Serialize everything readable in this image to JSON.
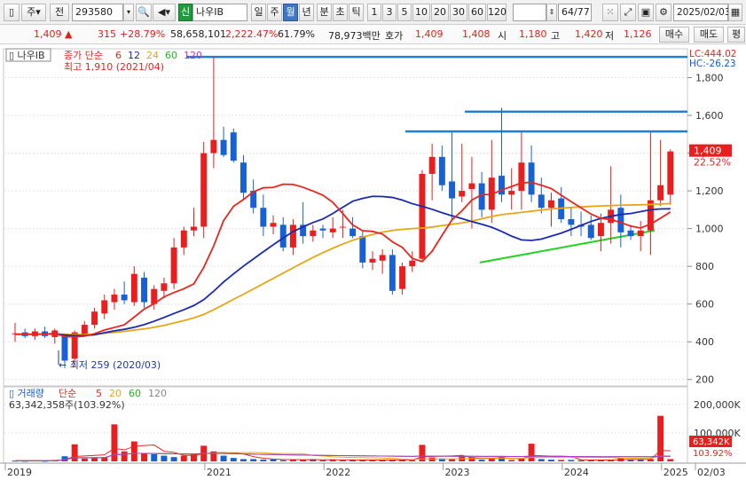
{
  "toolbar": {
    "market_btn": "주",
    "type_btn": "전",
    "code": "293580",
    "new_badge": "신",
    "name": "나우IB",
    "periods": [
      "일",
      "주",
      "월",
      "년",
      "분",
      "초",
      "틱"
    ],
    "selected_period": "월",
    "intervals": [
      "1",
      "3",
      "5",
      "10",
      "20",
      "30",
      "60",
      "120"
    ],
    "page": "64/77",
    "date": "2025/02/03"
  },
  "quote": {
    "price": "1,409",
    "arrow": "▲",
    "change": "315",
    "change_pct": "+28.79%",
    "volume": "58,658,101",
    "vol_pct": "2,222.47%",
    "turnover_pct": "61.79%",
    "amount": "78,973백만",
    "hoga_label": "호가",
    "ask": "1,409",
    "bid": "1,408",
    "open_label": "시",
    "open": "1,180",
    "high_label": "고",
    "high": "1,420",
    "low_label": "저",
    "low": "1,126",
    "buy_btn": "매수",
    "sell_btn": "매도",
    "eval_btn": "평"
  },
  "price_panel": {
    "name_tag": "나우IB",
    "ma_label": "종가 단순",
    "ma_periods": [
      "6",
      "12",
      "24",
      "60",
      "120"
    ],
    "ma_colors": [
      "#e8261d",
      "#1a2bb0",
      "#e8a617",
      "#1fb81f",
      "#b535c8"
    ],
    "high_note": "최고 1,910 (2021/04)",
    "low_note": "최저 259 (2020/03)",
    "lc": "LC:444.02",
    "hc": "HC:-26.23",
    "last_price": "1,409",
    "last_pct": "22.52%"
  },
  "volume_panel": {
    "title": "거래량",
    "ma_label": "단순",
    "ma_periods": [
      "5",
      "20",
      "60",
      "120"
    ],
    "ma_colors": [
      "#e8261d",
      "#e8a617",
      "#1fb81f",
      "#888888"
    ],
    "value_text": "63,342,358주(103.92%)",
    "tag_value": "63,342K",
    "tag_pct": "103.92%"
  },
  "x_axis": [
    "2019",
    "2021",
    "2022",
    "2023",
    "2024",
    "2025",
    "02/03"
  ],
  "chart_data": {
    "type": "candlestick",
    "price_axis_ticks": [
      200,
      400,
      600,
      800,
      "1,000",
      "1,200",
      "1,400",
      "1,600",
      "1,800"
    ],
    "volume_axis_ticks": [
      "100,000K",
      "200,000K"
    ],
    "ylim": [
      180,
      1920
    ],
    "volume_ylim": [
      0,
      240000
    ],
    "bars": [
      {
        "o": 440,
        "h": 500,
        "l": 400,
        "c": 445
      },
      {
        "o": 450,
        "h": 470,
        "l": 420,
        "c": 430
      },
      {
        "o": 430,
        "h": 470,
        "l": 410,
        "c": 455
      },
      {
        "o": 455,
        "h": 480,
        "l": 420,
        "c": 430
      },
      {
        "o": 425,
        "h": 470,
        "l": 390,
        "c": 460
      },
      {
        "o": 430,
        "h": 440,
        "l": 260,
        "c": 300
      },
      {
        "o": 310,
        "h": 460,
        "l": 270,
        "c": 450
      },
      {
        "o": 440,
        "h": 510,
        "l": 430,
        "c": 490
      },
      {
        "o": 490,
        "h": 580,
        "l": 470,
        "c": 560
      },
      {
        "o": 550,
        "h": 650,
        "l": 520,
        "c": 620
      },
      {
        "o": 610,
        "h": 680,
        "l": 570,
        "c": 650
      },
      {
        "o": 650,
        "h": 720,
        "l": 600,
        "c": 620
      },
      {
        "o": 610,
        "h": 800,
        "l": 590,
        "c": 760
      },
      {
        "o": 740,
        "h": 770,
        "l": 580,
        "c": 610
      },
      {
        "o": 600,
        "h": 700,
        "l": 570,
        "c": 680
      },
      {
        "o": 670,
        "h": 740,
        "l": 630,
        "c": 710
      },
      {
        "o": 710,
        "h": 950,
        "l": 680,
        "c": 900
      },
      {
        "o": 900,
        "h": 1010,
        "l": 860,
        "c": 990
      },
      {
        "o": 990,
        "h": 1110,
        "l": 960,
        "c": 1010
      },
      {
        "o": 1010,
        "h": 1460,
        "l": 950,
        "c": 1400
      },
      {
        "o": 1400,
        "h": 1910,
        "l": 1320,
        "c": 1470
      },
      {
        "o": 1470,
        "h": 1540,
        "l": 1380,
        "c": 1390
      },
      {
        "o": 1510,
        "h": 1530,
        "l": 1350,
        "c": 1360
      },
      {
        "o": 1350,
        "h": 1390,
        "l": 1150,
        "c": 1190
      },
      {
        "o": 1200,
        "h": 1260,
        "l": 1080,
        "c": 1110
      },
      {
        "o": 1110,
        "h": 1180,
        "l": 960,
        "c": 1010
      },
      {
        "o": 1010,
        "h": 1070,
        "l": 970,
        "c": 1030
      },
      {
        "o": 1020,
        "h": 1060,
        "l": 880,
        "c": 900
      },
      {
        "o": 900,
        "h": 1050,
        "l": 860,
        "c": 1020
      },
      {
        "o": 1020,
        "h": 1140,
        "l": 920,
        "c": 960
      },
      {
        "o": 960,
        "h": 1020,
        "l": 930,
        "c": 990
      },
      {
        "o": 1000,
        "h": 1020,
        "l": 950,
        "c": 990
      },
      {
        "o": 980,
        "h": 1060,
        "l": 950,
        "c": 1000
      },
      {
        "o": 1010,
        "h": 1100,
        "l": 950,
        "c": 1010
      },
      {
        "o": 1000,
        "h": 1060,
        "l": 950,
        "c": 960
      },
      {
        "o": 960,
        "h": 990,
        "l": 790,
        "c": 820
      },
      {
        "o": 820,
        "h": 880,
        "l": 780,
        "c": 840
      },
      {
        "o": 830,
        "h": 890,
        "l": 760,
        "c": 860
      },
      {
        "o": 860,
        "h": 890,
        "l": 650,
        "c": 670
      },
      {
        "o": 680,
        "h": 820,
        "l": 650,
        "c": 800
      },
      {
        "o": 800,
        "h": 880,
        "l": 770,
        "c": 830
      },
      {
        "o": 840,
        "h": 1310,
        "l": 830,
        "c": 1290
      },
      {
        "o": 1290,
        "h": 1450,
        "l": 1150,
        "c": 1380
      },
      {
        "o": 1380,
        "h": 1440,
        "l": 1200,
        "c": 1230
      },
      {
        "o": 1250,
        "h": 1510,
        "l": 1040,
        "c": 1160
      },
      {
        "o": 1170,
        "h": 1450,
        "l": 1140,
        "c": 1200
      },
      {
        "o": 1210,
        "h": 1380,
        "l": 1000,
        "c": 1240
      },
      {
        "o": 1240,
        "h": 1300,
        "l": 1060,
        "c": 1100
      },
      {
        "o": 1100,
        "h": 1470,
        "l": 1030,
        "c": 1270
      },
      {
        "o": 1280,
        "h": 1640,
        "l": 1140,
        "c": 1180
      },
      {
        "o": 1180,
        "h": 1320,
        "l": 1100,
        "c": 1200
      },
      {
        "o": 1200,
        "h": 1510,
        "l": 1100,
        "c": 1350
      },
      {
        "o": 1350,
        "h": 1440,
        "l": 1140,
        "c": 1180
      },
      {
        "o": 1180,
        "h": 1270,
        "l": 1080,
        "c": 1110
      },
      {
        "o": 1110,
        "h": 1190,
        "l": 1010,
        "c": 1150
      },
      {
        "o": 1160,
        "h": 1220,
        "l": 1030,
        "c": 1050
      },
      {
        "o": 1050,
        "h": 1110,
        "l": 960,
        "c": 1020
      },
      {
        "o": 1020,
        "h": 1090,
        "l": 960,
        "c": 1010
      },
      {
        "o": 1020,
        "h": 1070,
        "l": 940,
        "c": 950
      },
      {
        "o": 960,
        "h": 1080,
        "l": 880,
        "c": 1030
      },
      {
        "o": 1030,
        "h": 1330,
        "l": 920,
        "c": 1100
      },
      {
        "o": 1110,
        "h": 1180,
        "l": 900,
        "c": 980
      },
      {
        "o": 990,
        "h": 1020,
        "l": 940,
        "c": 960
      },
      {
        "o": 960,
        "h": 1040,
        "l": 880,
        "c": 990
      },
      {
        "o": 990,
        "h": 1510,
        "l": 860,
        "c": 1150
      },
      {
        "o": 1150,
        "h": 1470,
        "l": 1120,
        "c": 1230
      },
      {
        "o": 1180,
        "h": 1420,
        "l": 1126,
        "c": 1409
      }
    ],
    "ma6": [
      440,
      440,
      440,
      441,
      444,
      428,
      426,
      430,
      443,
      462,
      476,
      490,
      531,
      573,
      602,
      638,
      661,
      681,
      707,
      794,
      908,
      1042,
      1118,
      1154,
      1195,
      1216,
      1218,
      1235,
      1234,
      1219,
      1199,
      1177,
      1139,
      1080,
      1019,
      989,
      985,
      971,
      930,
      900,
      842,
      825,
      880,
      964,
      1046,
      1094,
      1151,
      1180,
      1181,
      1205,
      1223,
      1242,
      1245,
      1230,
      1212,
      1177,
      1143,
      1110,
      1077,
      1054,
      1048,
      1032,
      1013,
      1003,
      1024,
      1055,
      1088
    ],
    "ma12": [
      440,
      440,
      440,
      441,
      442,
      436,
      433,
      433,
      437,
      448,
      458,
      466,
      477,
      491,
      509,
      529,
      550,
      570,
      592,
      623,
      668,
      717,
      760,
      801,
      839,
      877,
      914,
      950,
      984,
      1009,
      1032,
      1051,
      1080,
      1113,
      1145,
      1160,
      1171,
      1170,
      1165,
      1151,
      1132,
      1118,
      1102,
      1084,
      1068,
      1053,
      1037,
      1023,
      1007,
      985,
      960,
      940,
      937,
      944,
      960,
      976,
      996,
      1017,
      1038,
      1054,
      1065,
      1075,
      1080,
      1090,
      1100,
      1104,
      1105
    ],
    "ma24": [
      440,
      440,
      440,
      440,
      441,
      440,
      438,
      438,
      440,
      445,
      450,
      455,
      462,
      468,
      477,
      487,
      500,
      512,
      527,
      545,
      570,
      597,
      625,
      652,
      680,
      708,
      736,
      764,
      792,
      820,
      847,
      872,
      896,
      918,
      938,
      955,
      969,
      981,
      990,
      996,
      1000,
      1003,
      1008,
      1016,
      1023,
      1030,
      1040,
      1052,
      1064,
      1074,
      1080,
      1086,
      1092,
      1098,
      1104,
      1108,
      1112,
      1115,
      1118,
      1120,
      1122,
      1124,
      1125,
      1126,
      1128,
      1130,
      1133
    ]
  },
  "volume_bars": [
    {
      "v": 2500,
      "up": false
    },
    {
      "v": 2000,
      "up": false
    },
    {
      "v": 3000,
      "up": true
    },
    {
      "v": 2000,
      "up": false
    },
    {
      "v": 5000,
      "up": true
    },
    {
      "v": 18000,
      "up": false
    },
    {
      "v": 60000,
      "up": true
    },
    {
      "v": 10000,
      "up": true
    },
    {
      "v": 12000,
      "up": true
    },
    {
      "v": 15000,
      "up": true
    },
    {
      "v": 130000,
      "up": true
    },
    {
      "v": 35000,
      "up": true
    },
    {
      "v": 70000,
      "up": true
    },
    {
      "v": 28000,
      "up": true
    },
    {
      "v": 25000,
      "up": false
    },
    {
      "v": 20000,
      "up": false
    },
    {
      "v": 15000,
      "up": false
    },
    {
      "v": 20000,
      "up": true
    },
    {
      "v": 25000,
      "up": true
    },
    {
      "v": 55000,
      "up": true
    },
    {
      "v": 35000,
      "up": true
    },
    {
      "v": 20000,
      "up": false
    },
    {
      "v": 12000,
      "up": false
    },
    {
      "v": 8000,
      "up": false
    },
    {
      "v": 8000,
      "up": false
    },
    {
      "v": 6000,
      "up": false
    },
    {
      "v": 7000,
      "up": false
    },
    {
      "v": 4000,
      "up": false
    },
    {
      "v": 6000,
      "up": true
    },
    {
      "v": 6000,
      "up": true
    },
    {
      "v": 8000,
      "up": false
    },
    {
      "v": 4000,
      "up": false
    },
    {
      "v": 5000,
      "up": true
    },
    {
      "v": 4000,
      "up": true
    },
    {
      "v": 5000,
      "up": false
    },
    {
      "v": 5000,
      "up": false
    },
    {
      "v": 5000,
      "up": true
    },
    {
      "v": 4000,
      "up": false
    },
    {
      "v": 6000,
      "up": false
    },
    {
      "v": 5000,
      "up": true
    },
    {
      "v": 5000,
      "up": true
    },
    {
      "v": 58000,
      "up": true
    },
    {
      "v": 14000,
      "up": true
    },
    {
      "v": 10000,
      "up": false
    },
    {
      "v": 8000,
      "up": true
    },
    {
      "v": 18000,
      "up": true
    },
    {
      "v": 15000,
      "up": true
    },
    {
      "v": 6000,
      "up": false
    },
    {
      "v": 10000,
      "up": true
    },
    {
      "v": 15000,
      "up": false
    },
    {
      "v": 5000,
      "up": true
    },
    {
      "v": 10000,
      "up": true
    },
    {
      "v": 62000,
      "up": true
    },
    {
      "v": 8000,
      "up": false
    },
    {
      "v": 6000,
      "up": false
    },
    {
      "v": 5000,
      "up": true
    },
    {
      "v": 5000,
      "up": false
    },
    {
      "v": 4000,
      "up": false
    },
    {
      "v": 4000,
      "up": false
    },
    {
      "v": 5000,
      "up": false
    },
    {
      "v": 5000,
      "up": true
    },
    {
      "v": 12000,
      "up": true
    },
    {
      "v": 5000,
      "up": false
    },
    {
      "v": 6000,
      "up": false
    },
    {
      "v": 8000,
      "up": true
    },
    {
      "v": 160000,
      "up": true
    },
    {
      "v": 8000,
      "up": true
    }
  ]
}
